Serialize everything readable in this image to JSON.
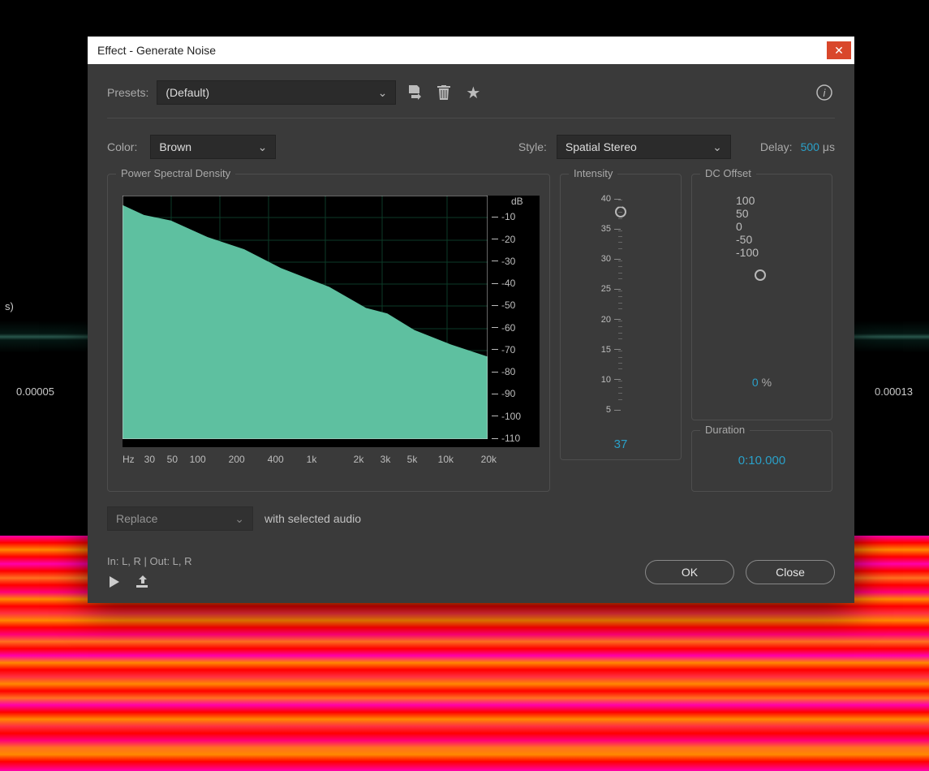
{
  "bg": {
    "left_time": "0.00005",
    "right_time": "0.00013",
    "axis_s": "s)"
  },
  "dialog": {
    "title": "Effect - Generate Noise",
    "presets": {
      "label": "Presets:",
      "value": "(Default)"
    },
    "row": {
      "color_label": "Color:",
      "color_value": "Brown",
      "style_label": "Style:",
      "style_value": "Spatial Stereo",
      "delay_label": "Delay:",
      "delay_value": "500",
      "delay_unit": "μs"
    },
    "psd": {
      "title": "Power Spectral Density",
      "y_unit": "dB",
      "y_ticks": [
        "-10",
        "-20",
        "-30",
        "-40",
        "-50",
        "-60",
        "-70",
        "-80",
        "-90",
        "-100",
        "-110"
      ],
      "x_unit": "Hz",
      "x_ticks": [
        "30",
        "50",
        "100",
        "200",
        "400",
        "1k",
        "2k",
        "3k",
        "5k",
        "10k",
        "20k"
      ]
    },
    "intensity": {
      "title": "Intensity",
      "max": 40,
      "min": 2,
      "ticks": [
        "40",
        "35",
        "30",
        "25",
        "20",
        "15",
        "10",
        "5"
      ],
      "value": "37"
    },
    "dcoffset": {
      "title": "DC Offset",
      "ticks": [
        "100",
        "50",
        "0",
        "-50",
        "-100"
      ],
      "value": "0",
      "unit": "%"
    },
    "duration": {
      "title": "Duration",
      "value": "0:10.000"
    },
    "replace": {
      "value": "Replace",
      "text": "with selected audio"
    },
    "footer": {
      "io": "In: L, R | Out: L, R",
      "ok": "OK",
      "close": "Close"
    }
  },
  "chart_data": {
    "type": "area",
    "title": "Power Spectral Density",
    "xlabel": "Hz",
    "ylabel": "dB",
    "x_log": true,
    "xlim": [
      20,
      20000
    ],
    "ylim": [
      -110,
      0
    ],
    "x": [
      20,
      30,
      50,
      100,
      200,
      400,
      1000,
      2000,
      3000,
      5000,
      10000,
      20000
    ],
    "y": [
      -5,
      -8,
      -12,
      -18,
      -25,
      -32,
      -42,
      -50,
      -54,
      -60,
      -68,
      -72
    ]
  }
}
